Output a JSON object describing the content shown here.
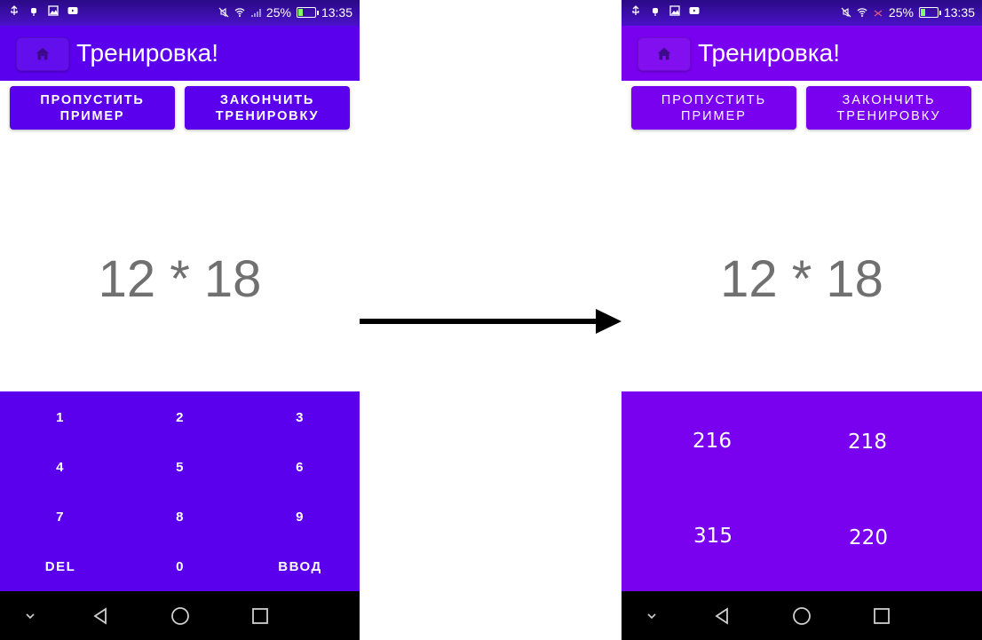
{
  "status": {
    "battery": "25%",
    "time": "13:35",
    "left_icons": [
      "usb-icon",
      "android-debug-icon",
      "image-icon",
      "youtube-icon"
    ],
    "right_icons": [
      "mute-icon",
      "wifi-icon",
      "no-signal-icon",
      "battery-icon"
    ]
  },
  "app": {
    "title": "Тренировка!",
    "home_icon": "home-icon",
    "skip_label": "ПРОПУСТИТЬ\nПРИМЕР",
    "finish_label": "ЗАКОНЧИТЬ\nТРЕНИРОВКУ"
  },
  "problem": "12 * 18",
  "keypad": {
    "keys": [
      "1",
      "2",
      "3",
      "4",
      "5",
      "6",
      "7",
      "8",
      "9",
      "DEL",
      "0",
      "ВВОД"
    ]
  },
  "answers": [
    "216",
    "218",
    "315",
    "220"
  ],
  "navbar": {
    "icons": [
      "collapse-icon",
      "back-icon",
      "home-circle-icon",
      "recents-icon"
    ]
  },
  "colors": {
    "appbar_left": "#5a00ec",
    "appbar_right": "#7a00f0",
    "problem_text": "#707070"
  }
}
